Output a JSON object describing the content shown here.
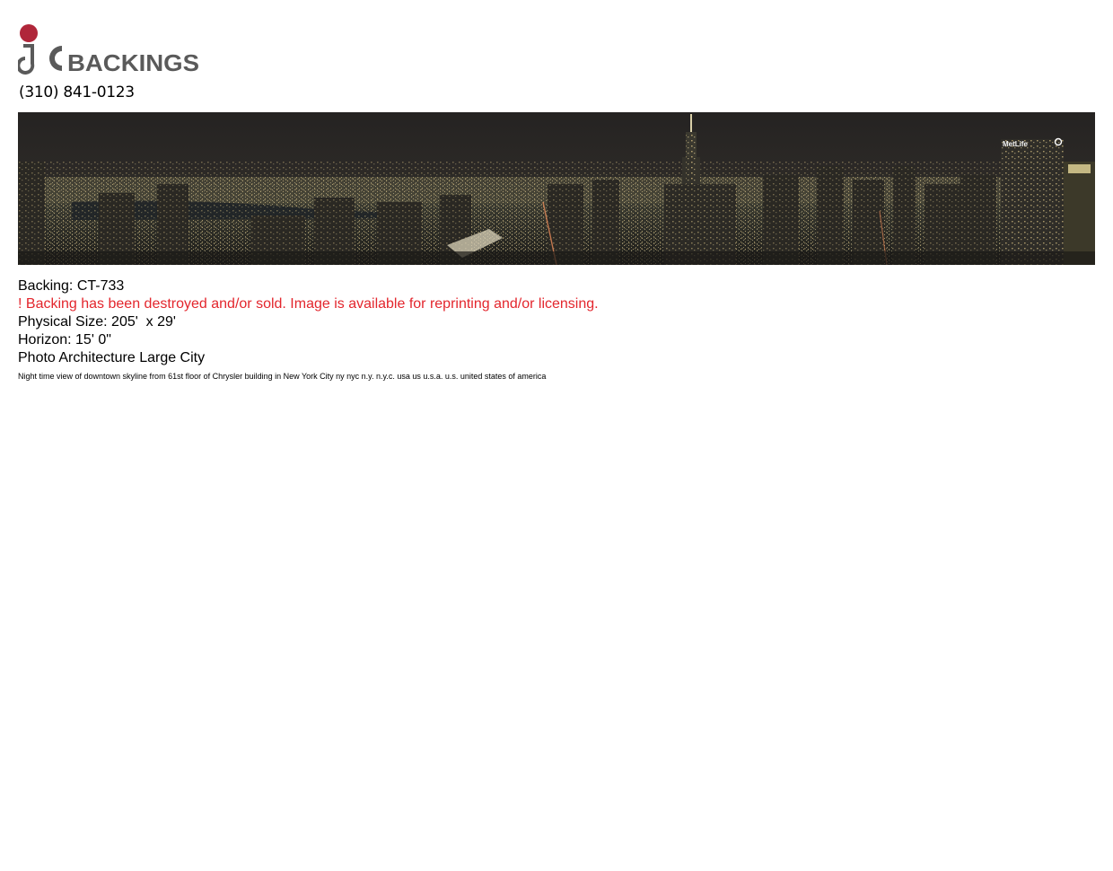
{
  "header": {
    "logo_text": "BACKINGS",
    "phone": "(310) 841-0123"
  },
  "banner": {
    "sign_text": "MetLife"
  },
  "details": {
    "backing": "Backing: CT-733",
    "warning": "! Backing has been destroyed and/or sold. Image is available for reprinting and/or licensing.",
    "physical_size": "Physical Size: 205'  x 29'",
    "horizon": "Horizon: 15' 0\"",
    "category": "Photo Architecture Large City",
    "description": "Night time view of downtown skyline from 61st floor of Chrysler building in New York City ny nyc n.y. n.y.c. usa us u.s.a. u.s. united states of america"
  },
  "colors": {
    "brand_red": "#b0263a",
    "logo_gray": "#5a5a5a",
    "warning_red": "#e3262d",
    "night_sky": "#2b2826"
  }
}
